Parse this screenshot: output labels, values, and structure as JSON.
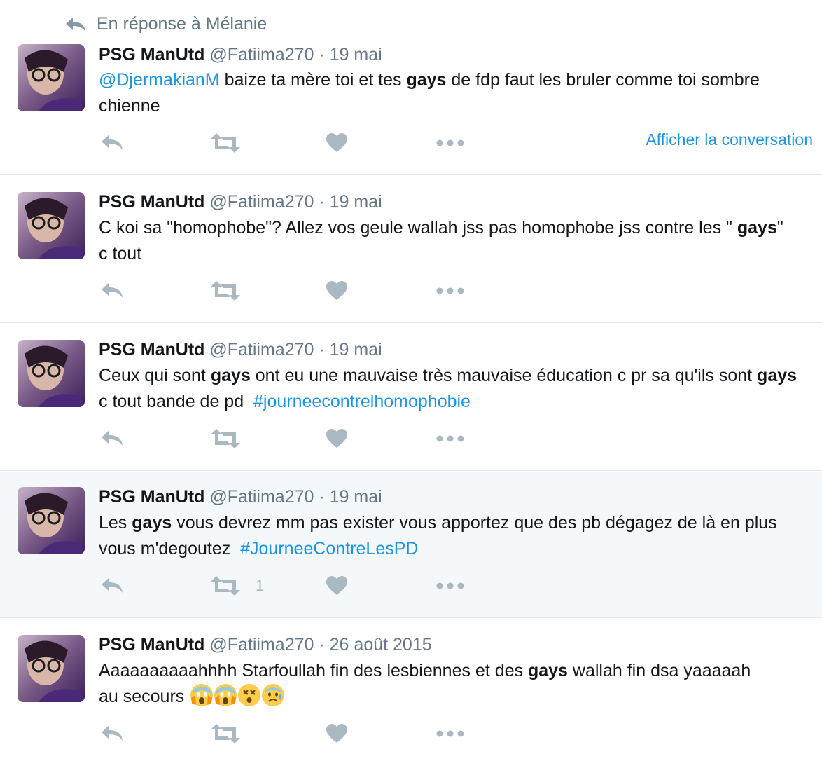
{
  "reply_context": "En réponse à Mélanie",
  "conversation_link": "Afficher la conversation",
  "tweets": [
    {
      "name": "PSG ManUtd",
      "handle": "@Fatiima270",
      "separator": "·",
      "date": "19 mai",
      "parts": [
        {
          "t": "@DjermakianM",
          "k": "link"
        },
        {
          "t": " baize ta mère toi et tes ",
          "k": "text"
        },
        {
          "t": "gays",
          "k": "bold"
        },
        {
          "t": " de fdp faut les bruler comme toi sombre chienne",
          "k": "text"
        }
      ],
      "retweet_count": ""
    },
    {
      "name": "PSG ManUtd",
      "handle": "@Fatiima270",
      "separator": "·",
      "date": "19 mai",
      "parts": [
        {
          "t": "C koi sa \"homophobe\"? Allez vos geule wallah jss pas homophobe jss contre les \" ",
          "k": "text"
        },
        {
          "t": "gays",
          "k": "bold"
        },
        {
          "t": "\" c tout",
          "k": "text"
        }
      ],
      "retweet_count": ""
    },
    {
      "name": "PSG ManUtd",
      "handle": "@Fatiima270",
      "separator": "·",
      "date": "19 mai",
      "parts": [
        {
          "t": "Ceux qui sont ",
          "k": "text"
        },
        {
          "t": "gays",
          "k": "bold"
        },
        {
          "t": " ont eu une mauvaise très mauvaise éducation c pr sa qu'ils sont ",
          "k": "text"
        },
        {
          "t": "gays",
          "k": "bold"
        },
        {
          "t": " c tout bande de pd  ",
          "k": "text"
        },
        {
          "t": "#journeecontrelhomophobie",
          "k": "link"
        }
      ],
      "retweet_count": ""
    },
    {
      "name": "PSG ManUtd",
      "handle": "@Fatiima270",
      "separator": "·",
      "date": "19 mai",
      "parts": [
        {
          "t": "Les ",
          "k": "text"
        },
        {
          "t": "gays",
          "k": "bold"
        },
        {
          "t": " vous devrez mm pas exister vous apportez que des pb dégagez de là en plus vous m'degoutez  ",
          "k": "text"
        },
        {
          "t": "#JourneeContreLesPD",
          "k": "link"
        }
      ],
      "retweet_count": "1"
    },
    {
      "name": "PSG ManUtd",
      "handle": "@Fatiima270",
      "separator": "·",
      "date": "26 août 2015",
      "parts": [
        {
          "t": "Aaaaaaaaaahhhh Starfoullah fin des lesbiennes et des ",
          "k": "text"
        },
        {
          "t": "gays",
          "k": "bold"
        },
        {
          "t": " wallah fin dsa yaaaaah au secours ",
          "k": "text"
        }
      ],
      "emojis": [
        "scream",
        "scream",
        "dizzy-face",
        "anxious-sweat"
      ],
      "retweet_count": ""
    }
  ],
  "colors": {
    "link": "#1b95e0",
    "muted": "#657786",
    "icon": "#aab8c2",
    "highlight_bg": "#f5f8fa",
    "divider": "#e1e8ed"
  }
}
